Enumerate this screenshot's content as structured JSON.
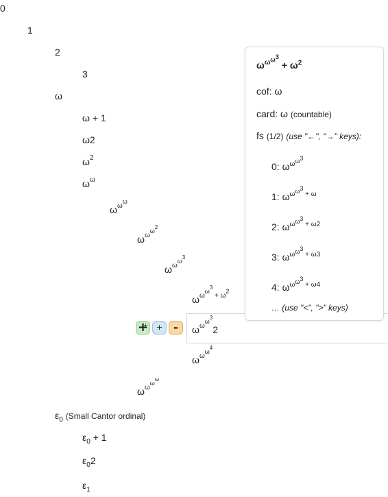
{
  "tree": {
    "rows": [
      {
        "label": "0"
      },
      {
        "label": "1"
      },
      {
        "label": "2"
      },
      {
        "label": "3"
      },
      {
        "label": "ω"
      },
      {
        "label": "ω + 1"
      },
      {
        "label": "ω2"
      },
      {
        "base": "ω",
        "exp": "2"
      },
      {
        "base": "ω",
        "exp": "ω"
      },
      {
        "base": "ω",
        "exp1": "ω",
        "exp2": "ω"
      },
      {
        "base": "ω",
        "exp1": "ω",
        "exp2": "ω",
        "exp3": "2"
      },
      {
        "base": "ω",
        "exp1": "ω",
        "exp2": "ω",
        "exp3": "3"
      },
      {
        "base": "ω",
        "exp1": "ω",
        "exp2": "ω",
        "exp3": "3",
        "tail": " + ω",
        "tailexp": "2"
      },
      {
        "base": "ω",
        "exp1": "ω",
        "exp2": "ω",
        "exp3": "3",
        "tail": "2"
      },
      {
        "base": "ω",
        "exp1": "ω",
        "exp2": "ω",
        "exp3": "4"
      },
      {
        "base": "ω",
        "exp1": "ω",
        "exp2": "ω",
        "exp3": "ω"
      },
      {
        "base": "ε",
        "sub": "0",
        "note": "(Small Cantor ordinal)"
      },
      {
        "base": "ε",
        "sub": "0",
        "tail": " + 1"
      },
      {
        "base": "ε",
        "sub": "0",
        "tail": "2"
      },
      {
        "base": "ε",
        "sub": "1"
      }
    ]
  },
  "controls": {
    "add_big": "+",
    "add_big_small": "+",
    "add_small": "+",
    "remove": "-"
  },
  "popup": {
    "title_base": "ω",
    "title_e1": "ω",
    "title_e2": "ω",
    "title_e3": "3",
    "title_tail": " + ω",
    "title_tailexp": "2",
    "cof_label": "cof: ",
    "cof_value": "ω",
    "card_label": "card: ",
    "card_value": "ω",
    "card_note": "(countable)",
    "fs_label": "fs ",
    "fs_count": "(1/2)",
    "fs_hint": "(use \"←\", \"→\" keys):",
    "fs_items": [
      {
        "idx": "0: ",
        "tail": ""
      },
      {
        "idx": "1: ",
        "tail": " + ω"
      },
      {
        "idx": "2: ",
        "tail": " + ω2"
      },
      {
        "idx": "3: ",
        "tail": " + ω3"
      },
      {
        "idx": "4: ",
        "tail": " + ω4"
      }
    ],
    "more_hint": "… (use \"<\", \">\" keys)"
  }
}
